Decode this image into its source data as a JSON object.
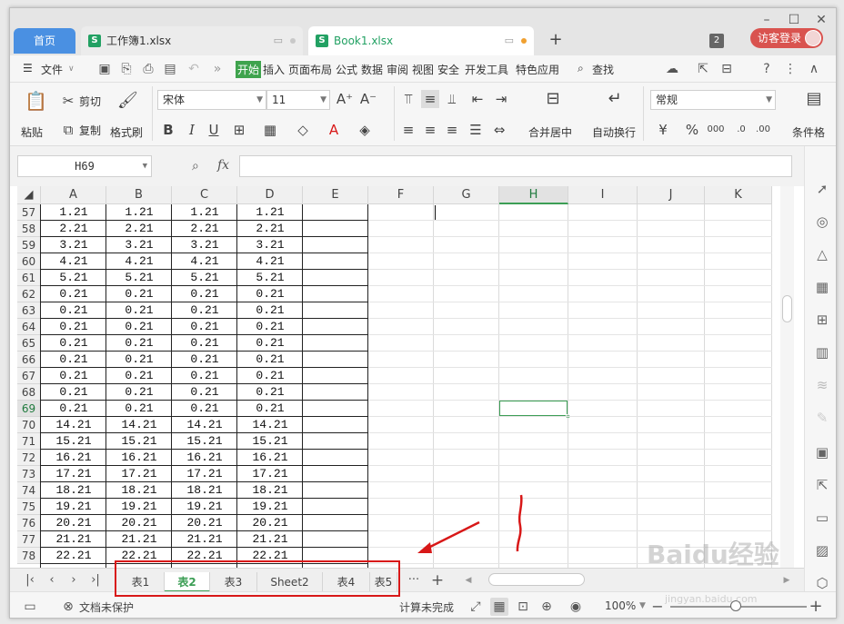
{
  "titlebar": {
    "home_tab": "首页",
    "doc_tabs": [
      {
        "label": "工作簿1.xlsx",
        "dot_color": "#c8c8c8"
      },
      {
        "label": "Book1.xlsx",
        "dot_color": "#f0a030"
      }
    ],
    "new_tab": "+",
    "tab_count": "2",
    "login_label": "访客登录"
  },
  "menu": {
    "file": "文件",
    "items": [
      "开始",
      "插入",
      "页面布局",
      "公式",
      "数据",
      "审阅",
      "视图",
      "安全",
      "开发工具",
      "特色应用"
    ],
    "active": "开始",
    "search": "查找"
  },
  "ribbon": {
    "paste": "粘贴",
    "cut": "剪切",
    "copy": "复制",
    "format_painter": "格式刷",
    "font_name": "宋体",
    "font_size": "11",
    "merge_center": "合并居中",
    "wrap_text": "自动换行",
    "number_format": "常规",
    "conditional_format": "条件格",
    "bold": "B",
    "italic": "I",
    "underline": "U"
  },
  "formula_bar": {
    "name_box": "H69",
    "fx": "fx",
    "formula": ""
  },
  "grid": {
    "columns": [
      "A",
      "B",
      "C",
      "D",
      "E",
      "F",
      "G",
      "H",
      "I",
      "J",
      "K"
    ],
    "selected_column": "H",
    "selected_row": "69",
    "rows": [
      {
        "n": "57",
        "v": "1.21"
      },
      {
        "n": "58",
        "v": "2.21"
      },
      {
        "n": "59",
        "v": "3.21"
      },
      {
        "n": "60",
        "v": "4.21"
      },
      {
        "n": "61",
        "v": "5.21"
      },
      {
        "n": "62",
        "v": "0.21"
      },
      {
        "n": "63",
        "v": "0.21"
      },
      {
        "n": "64",
        "v": "0.21"
      },
      {
        "n": "65",
        "v": "0.21"
      },
      {
        "n": "66",
        "v": "0.21"
      },
      {
        "n": "67",
        "v": "0.21"
      },
      {
        "n": "68",
        "v": "0.21"
      },
      {
        "n": "69",
        "v": "0.21"
      },
      {
        "n": "70",
        "v": "14.21"
      },
      {
        "n": "71",
        "v": "15.21"
      },
      {
        "n": "72",
        "v": "16.21"
      },
      {
        "n": "73",
        "v": "17.21"
      },
      {
        "n": "74",
        "v": "18.21"
      },
      {
        "n": "75",
        "v": "19.21"
      },
      {
        "n": "76",
        "v": "20.21"
      },
      {
        "n": "77",
        "v": "21.21"
      },
      {
        "n": "78",
        "v": "22.21"
      }
    ]
  },
  "sheets": {
    "tabs": [
      "表1",
      "表2",
      "表3",
      "Sheet2",
      "表4",
      "表5"
    ],
    "active": "表2",
    "more": "···",
    "add": "+"
  },
  "status": {
    "protection": "文档未保护",
    "calc": "计算未完成",
    "zoom": "100%",
    "zoom_minus": "−",
    "zoom_plus": "+"
  },
  "watermark": {
    "text": "Baidu经验",
    "url": "jingyan.baidu.com"
  },
  "colors": {
    "accent_green": "#3c9e55",
    "annotation_red": "#d81818",
    "home_tab_blue": "#4a90e2",
    "login_red": "#d9534f"
  }
}
